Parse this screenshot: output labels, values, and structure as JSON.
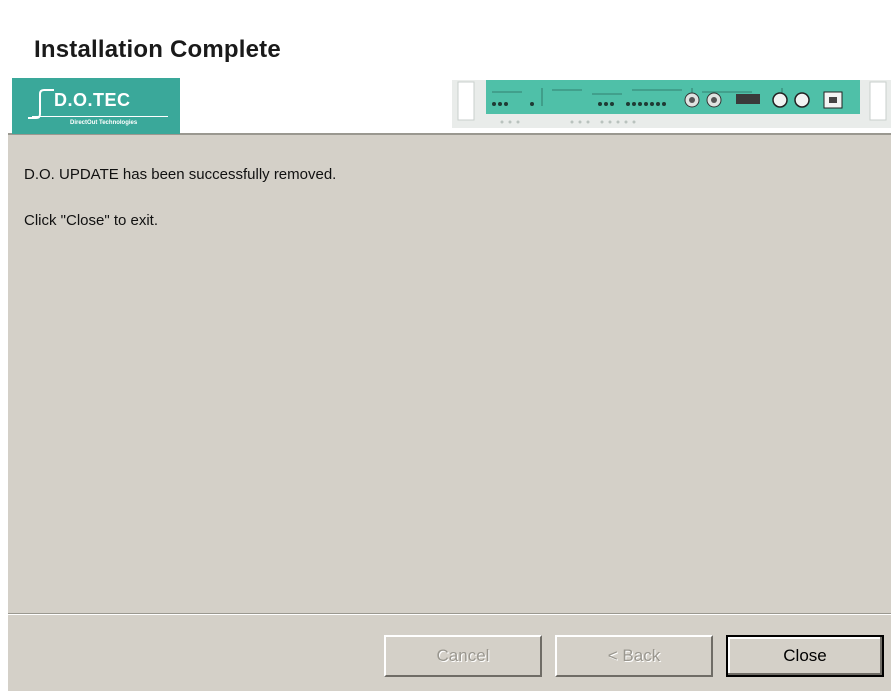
{
  "dialog": {
    "title": "Installation Complete",
    "message": "D.O. UPDATE has been successfully removed.",
    "instruction": "Click \"Close\" to exit."
  },
  "logo": {
    "brand": "D.O.TEC",
    "tagline": "DirectOut Technologies",
    "color": "#3aa89a"
  },
  "buttons": {
    "cancel": "Cancel",
    "back": "< Back",
    "close": "Close"
  },
  "colors": {
    "dialog_background": "#d4d0c8",
    "device_panel": "#4fc0a8"
  }
}
